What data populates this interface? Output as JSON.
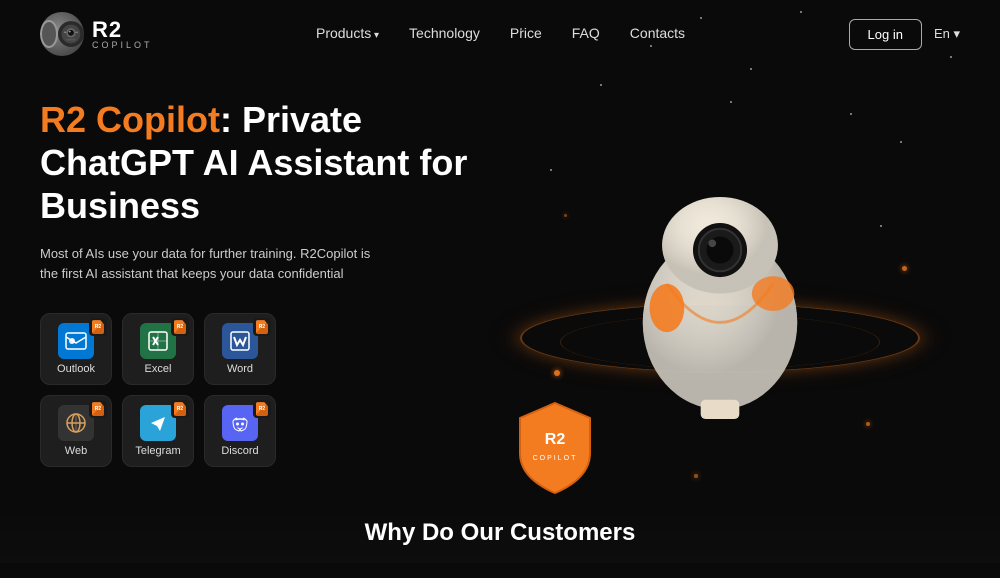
{
  "nav": {
    "logo_text": "R2",
    "logo_sub": "COPILOT",
    "links": [
      {
        "label": "Products",
        "has_arrow": true
      },
      {
        "label": "Technology",
        "has_arrow": false
      },
      {
        "label": "Price",
        "has_arrow": false
      },
      {
        "label": "FAQ",
        "has_arrow": false
      },
      {
        "label": "Contacts",
        "has_arrow": false
      }
    ],
    "login_label": "Log in",
    "lang_label": "En ▾"
  },
  "hero": {
    "title_orange": "R2 Copilot",
    "title_rest": ": Private ChatGPT AI Assistant for Business",
    "subtitle": "Most of AIs use your data for further training. R2Copilot is the first AI assistant that keeps your data confidential"
  },
  "apps": [
    {
      "id": "outlook",
      "label": "Outlook",
      "color": "#0078d4",
      "letter": "O",
      "font_color": "#fff"
    },
    {
      "id": "excel",
      "label": "Excel",
      "color": "#217346",
      "letter": "X",
      "font_color": "#fff"
    },
    {
      "id": "word",
      "label": "Word",
      "color": "#2b579a",
      "letter": "W",
      "font_color": "#fff"
    },
    {
      "id": "web",
      "label": "Web",
      "color": "#2a2a2a",
      "letter": "⊕",
      "font_color": "#d8a060"
    },
    {
      "id": "telegram",
      "label": "Telegram",
      "color": "#2aa3d8",
      "letter": "✈",
      "font_color": "#fff"
    },
    {
      "id": "discord",
      "label": "Discord",
      "color": "#5865F2",
      "letter": "⊞",
      "font_color": "#fff"
    }
  ],
  "bottom": {
    "teaser": "Why Do Our Customers"
  },
  "colors": {
    "orange": "#f47c20",
    "background": "#0a0a0a"
  }
}
